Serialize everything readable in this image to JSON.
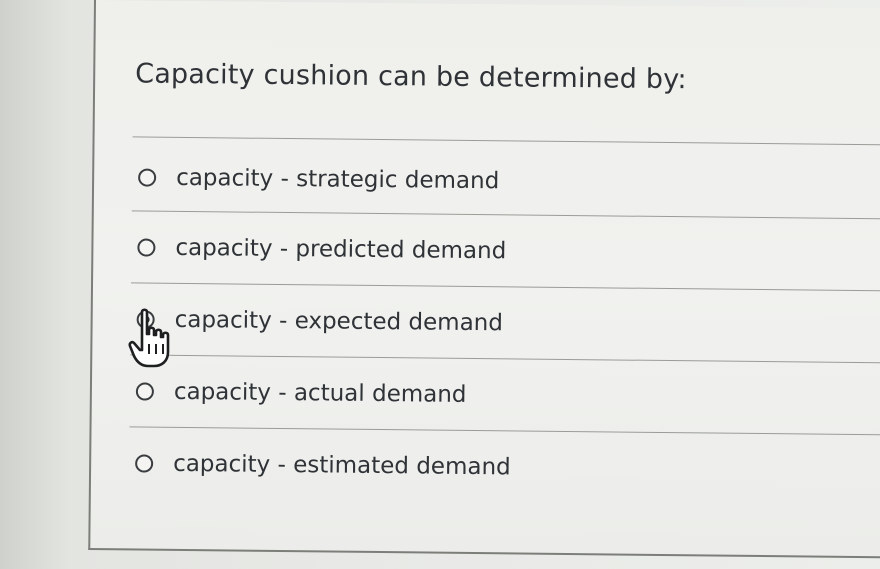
{
  "question": {
    "text": "Capacity cushion can be determined by:"
  },
  "options": [
    {
      "label": "capacity - strategic demand",
      "selected": false
    },
    {
      "label": "capacity - predicted demand",
      "selected": false
    },
    {
      "label": "capacity - expected demand",
      "selected": true
    },
    {
      "label": "capacity - actual demand",
      "selected": false
    },
    {
      "label": "capacity - estimated demand",
      "selected": false
    }
  ],
  "cursor": {
    "icon": "hand-pointer-icon"
  }
}
